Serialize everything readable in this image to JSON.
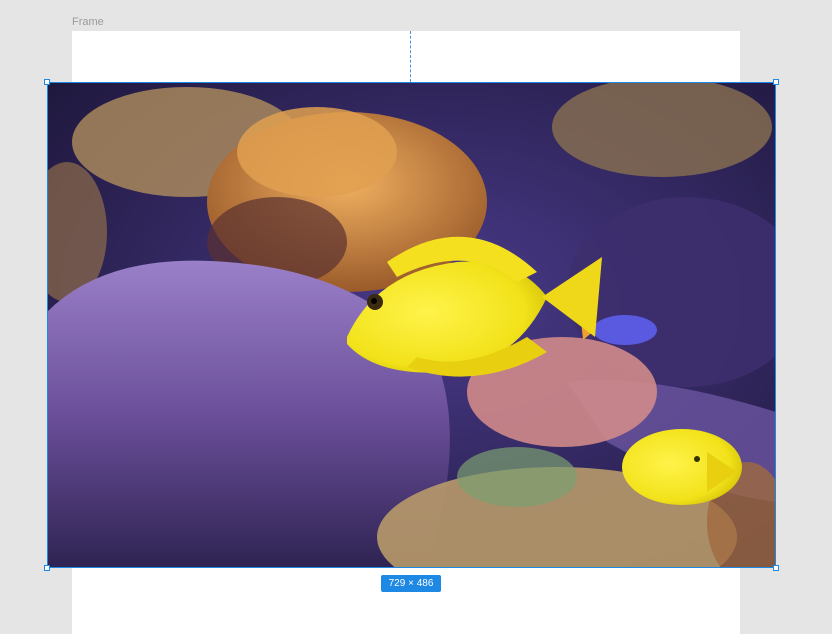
{
  "canvas": {
    "frame_label": "Frame"
  },
  "selection": {
    "size_label": "729 × 486"
  },
  "image": {
    "subject": "yellow-tang-fish-aquarium-photo",
    "colors": {
      "water": "#2b2250",
      "rock": "#6b4f9a",
      "coral": "#d88a3a",
      "fish": "#f2e21a"
    }
  },
  "colors": {
    "canvas_bg": "#e5e5e5",
    "frame_bg": "#ffffff",
    "selection_accent": "#1e88e5"
  }
}
